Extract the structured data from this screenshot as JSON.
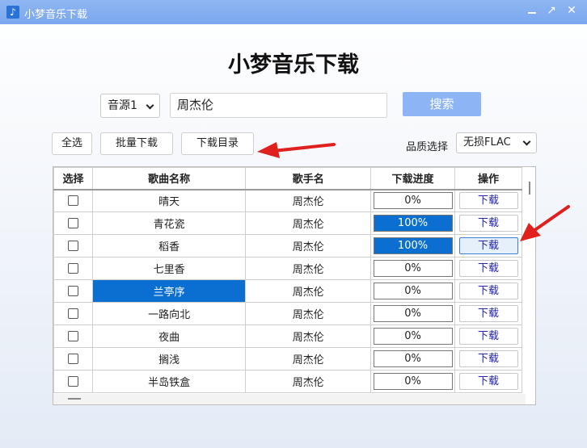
{
  "window": {
    "title": "小梦音乐下载",
    "app_icon": "music-note-icon",
    "controls": [
      "minimize-icon",
      "maximize-icon",
      "close-icon"
    ]
  },
  "heading": "小梦音乐下载",
  "search": {
    "source_selected": "音源1",
    "query": "周杰伦",
    "button_label": "搜索"
  },
  "toolbar": {
    "select_all": "全选",
    "batch_download": "批量下载",
    "download_dir": "下载目录",
    "quality_label": "品质选择",
    "quality_selected": "无损FLAC"
  },
  "table": {
    "headers": [
      "选择",
      "歌曲名称",
      "歌手名",
      "下载进度",
      "操作"
    ],
    "rows": [
      {
        "name": "晴天",
        "singer": "周杰伦",
        "progress": "0%",
        "progress_value": 0,
        "op": "下载"
      },
      {
        "name": "青花瓷",
        "singer": "周杰伦",
        "progress": "100%",
        "progress_value": 100,
        "op": "下载"
      },
      {
        "name": "稻香",
        "singer": "周杰伦",
        "progress": "100%",
        "progress_value": 100,
        "op": "下载"
      },
      {
        "name": "七里香",
        "singer": "周杰伦",
        "progress": "0%",
        "progress_value": 0,
        "op": "下载"
      },
      {
        "name": "兰亭序",
        "singer": "周杰伦",
        "progress": "0%",
        "progress_value": 0,
        "op": "下载"
      },
      {
        "name": "一路向北",
        "singer": "周杰伦",
        "progress": "0%",
        "progress_value": 0,
        "op": "下载"
      },
      {
        "name": "夜曲",
        "singer": "周杰伦",
        "progress": "0%",
        "progress_value": 0,
        "op": "下载"
      },
      {
        "name": "搁浅",
        "singer": "周杰伦",
        "progress": "0%",
        "progress_value": 0,
        "op": "下载"
      },
      {
        "name": "半岛铁盒",
        "singer": "周杰伦",
        "progress": "0%",
        "progress_value": 0,
        "op": "下载"
      }
    ]
  },
  "colors": {
    "titlebar": "#7aa7ee",
    "accent": "#0a6fd1",
    "search_button": "#8db4f5",
    "annotation_arrow": "#e0201c"
  }
}
